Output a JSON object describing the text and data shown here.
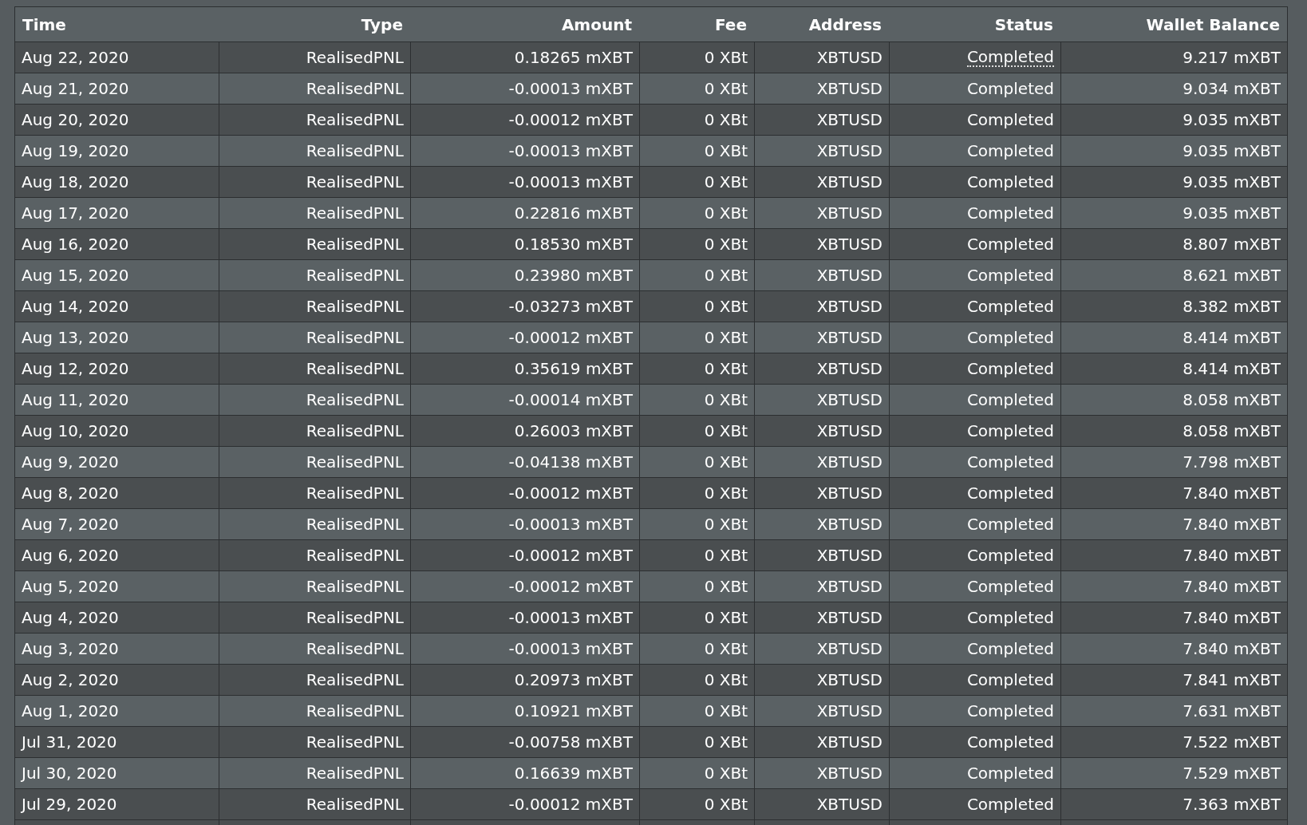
{
  "table": {
    "columns": [
      "Time",
      "Type",
      "Amount",
      "Fee",
      "Address",
      "Status",
      "Wallet Balance"
    ],
    "rows": [
      {
        "time": "Aug 22, 2020",
        "type": "RealisedPNL",
        "amount": "0.18265 mXBT",
        "fee": "0 XBt",
        "address": "XBTUSD",
        "status": "Completed",
        "status_underlined": true,
        "wallet_balance": "9.217 mXBT"
      },
      {
        "time": "Aug 21, 2020",
        "type": "RealisedPNL",
        "amount": "-0.00013 mXBT",
        "fee": "0 XBt",
        "address": "XBTUSD",
        "status": "Completed",
        "status_underlined": false,
        "wallet_balance": "9.034 mXBT"
      },
      {
        "time": "Aug 20, 2020",
        "type": "RealisedPNL",
        "amount": "-0.00012 mXBT",
        "fee": "0 XBt",
        "address": "XBTUSD",
        "status": "Completed",
        "status_underlined": false,
        "wallet_balance": "9.035 mXBT"
      },
      {
        "time": "Aug 19, 2020",
        "type": "RealisedPNL",
        "amount": "-0.00013 mXBT",
        "fee": "0 XBt",
        "address": "XBTUSD",
        "status": "Completed",
        "status_underlined": false,
        "wallet_balance": "9.035 mXBT"
      },
      {
        "time": "Aug 18, 2020",
        "type": "RealisedPNL",
        "amount": "-0.00013 mXBT",
        "fee": "0 XBt",
        "address": "XBTUSD",
        "status": "Completed",
        "status_underlined": false,
        "wallet_balance": "9.035 mXBT"
      },
      {
        "time": "Aug 17, 2020",
        "type": "RealisedPNL",
        "amount": "0.22816 mXBT",
        "fee": "0 XBt",
        "address": "XBTUSD",
        "status": "Completed",
        "status_underlined": false,
        "wallet_balance": "9.035 mXBT"
      },
      {
        "time": "Aug 16, 2020",
        "type": "RealisedPNL",
        "amount": "0.18530 mXBT",
        "fee": "0 XBt",
        "address": "XBTUSD",
        "status": "Completed",
        "status_underlined": false,
        "wallet_balance": "8.807 mXBT"
      },
      {
        "time": "Aug 15, 2020",
        "type": "RealisedPNL",
        "amount": "0.23980 mXBT",
        "fee": "0 XBt",
        "address": "XBTUSD",
        "status": "Completed",
        "status_underlined": false,
        "wallet_balance": "8.621 mXBT"
      },
      {
        "time": "Aug 14, 2020",
        "type": "RealisedPNL",
        "amount": "-0.03273 mXBT",
        "fee": "0 XBt",
        "address": "XBTUSD",
        "status": "Completed",
        "status_underlined": false,
        "wallet_balance": "8.382 mXBT"
      },
      {
        "time": "Aug 13, 2020",
        "type": "RealisedPNL",
        "amount": "-0.00012 mXBT",
        "fee": "0 XBt",
        "address": "XBTUSD",
        "status": "Completed",
        "status_underlined": false,
        "wallet_balance": "8.414 mXBT"
      },
      {
        "time": "Aug 12, 2020",
        "type": "RealisedPNL",
        "amount": "0.35619 mXBT",
        "fee": "0 XBt",
        "address": "XBTUSD",
        "status": "Completed",
        "status_underlined": false,
        "wallet_balance": "8.414 mXBT"
      },
      {
        "time": "Aug 11, 2020",
        "type": "RealisedPNL",
        "amount": "-0.00014 mXBT",
        "fee": "0 XBt",
        "address": "XBTUSD",
        "status": "Completed",
        "status_underlined": false,
        "wallet_balance": "8.058 mXBT"
      },
      {
        "time": "Aug 10, 2020",
        "type": "RealisedPNL",
        "amount": "0.26003 mXBT",
        "fee": "0 XBt",
        "address": "XBTUSD",
        "status": "Completed",
        "status_underlined": false,
        "wallet_balance": "8.058 mXBT"
      },
      {
        "time": "Aug 9, 2020",
        "type": "RealisedPNL",
        "amount": "-0.04138 mXBT",
        "fee": "0 XBt",
        "address": "XBTUSD",
        "status": "Completed",
        "status_underlined": false,
        "wallet_balance": "7.798 mXBT"
      },
      {
        "time": "Aug 8, 2020",
        "type": "RealisedPNL",
        "amount": "-0.00012 mXBT",
        "fee": "0 XBt",
        "address": "XBTUSD",
        "status": "Completed",
        "status_underlined": false,
        "wallet_balance": "7.840 mXBT"
      },
      {
        "time": "Aug 7, 2020",
        "type": "RealisedPNL",
        "amount": "-0.00013 mXBT",
        "fee": "0 XBt",
        "address": "XBTUSD",
        "status": "Completed",
        "status_underlined": false,
        "wallet_balance": "7.840 mXBT"
      },
      {
        "time": "Aug 6, 2020",
        "type": "RealisedPNL",
        "amount": "-0.00012 mXBT",
        "fee": "0 XBt",
        "address": "XBTUSD",
        "status": "Completed",
        "status_underlined": false,
        "wallet_balance": "7.840 mXBT"
      },
      {
        "time": "Aug 5, 2020",
        "type": "RealisedPNL",
        "amount": "-0.00012 mXBT",
        "fee": "0 XBt",
        "address": "XBTUSD",
        "status": "Completed",
        "status_underlined": false,
        "wallet_balance": "7.840 mXBT"
      },
      {
        "time": "Aug 4, 2020",
        "type": "RealisedPNL",
        "amount": "-0.00013 mXBT",
        "fee": "0 XBt",
        "address": "XBTUSD",
        "status": "Completed",
        "status_underlined": false,
        "wallet_balance": "7.840 mXBT"
      },
      {
        "time": "Aug 3, 2020",
        "type": "RealisedPNL",
        "amount": "-0.00013 mXBT",
        "fee": "0 XBt",
        "address": "XBTUSD",
        "status": "Completed",
        "status_underlined": false,
        "wallet_balance": "7.840 mXBT"
      },
      {
        "time": "Aug 2, 2020",
        "type": "RealisedPNL",
        "amount": "0.20973 mXBT",
        "fee": "0 XBt",
        "address": "XBTUSD",
        "status": "Completed",
        "status_underlined": false,
        "wallet_balance": "7.841 mXBT"
      },
      {
        "time": "Aug 1, 2020",
        "type": "RealisedPNL",
        "amount": "0.10921 mXBT",
        "fee": "0 XBt",
        "address": "XBTUSD",
        "status": "Completed",
        "status_underlined": false,
        "wallet_balance": "7.631 mXBT"
      },
      {
        "time": "Jul 31, 2020",
        "type": "RealisedPNL",
        "amount": "-0.00758 mXBT",
        "fee": "0 XBt",
        "address": "XBTUSD",
        "status": "Completed",
        "status_underlined": false,
        "wallet_balance": "7.522 mXBT"
      },
      {
        "time": "Jul 30, 2020",
        "type": "RealisedPNL",
        "amount": "0.16639 mXBT",
        "fee": "0 XBt",
        "address": "XBTUSD",
        "status": "Completed",
        "status_underlined": false,
        "wallet_balance": "7.529 mXBT"
      },
      {
        "time": "Jul 29, 2020",
        "type": "RealisedPNL",
        "amount": "-0.00012 mXBT",
        "fee": "0 XBt",
        "address": "XBTUSD",
        "status": "Completed",
        "status_underlined": false,
        "wallet_balance": "7.363 mXBT"
      }
    ]
  }
}
